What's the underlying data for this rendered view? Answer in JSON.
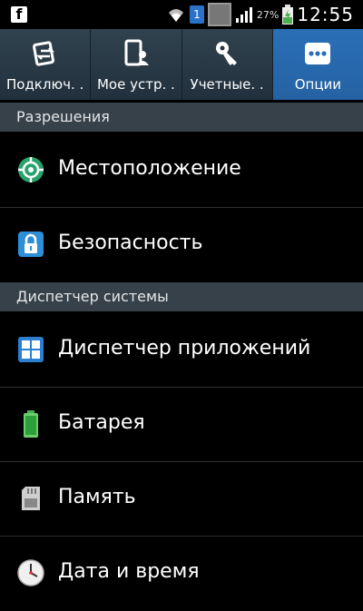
{
  "status_bar": {
    "app_icon_letter": "f",
    "notification_badge": "1",
    "battery_percent": "27%",
    "time": "12:55"
  },
  "tabs": [
    {
      "label": "Подключ. .",
      "icon": "connections-icon"
    },
    {
      "label": "Мое устр. .",
      "icon": "my-device-icon"
    },
    {
      "label": "Учетные. .",
      "icon": "accounts-key-icon"
    },
    {
      "label": "Опции",
      "icon": "more-options-icon",
      "active": true
    }
  ],
  "sections": [
    {
      "header": "Разрешения",
      "items": [
        {
          "label": "Местоположение",
          "icon": "location-icon"
        },
        {
          "label": "Безопасность",
          "icon": "lock-icon"
        }
      ]
    },
    {
      "header": "Диспетчер системы",
      "items": [
        {
          "label": "Диспетчер приложений",
          "icon": "apps-grid-icon"
        },
        {
          "label": "Батарея",
          "icon": "battery-icon"
        },
        {
          "label": "Память",
          "icon": "sd-card-icon"
        },
        {
          "label": "Дата и время",
          "icon": "clock-icon"
        }
      ]
    }
  ],
  "colors": {
    "active_tab": "#2a6fb7",
    "tab_bar": "#2b3a46",
    "section_header": "#36414a"
  }
}
